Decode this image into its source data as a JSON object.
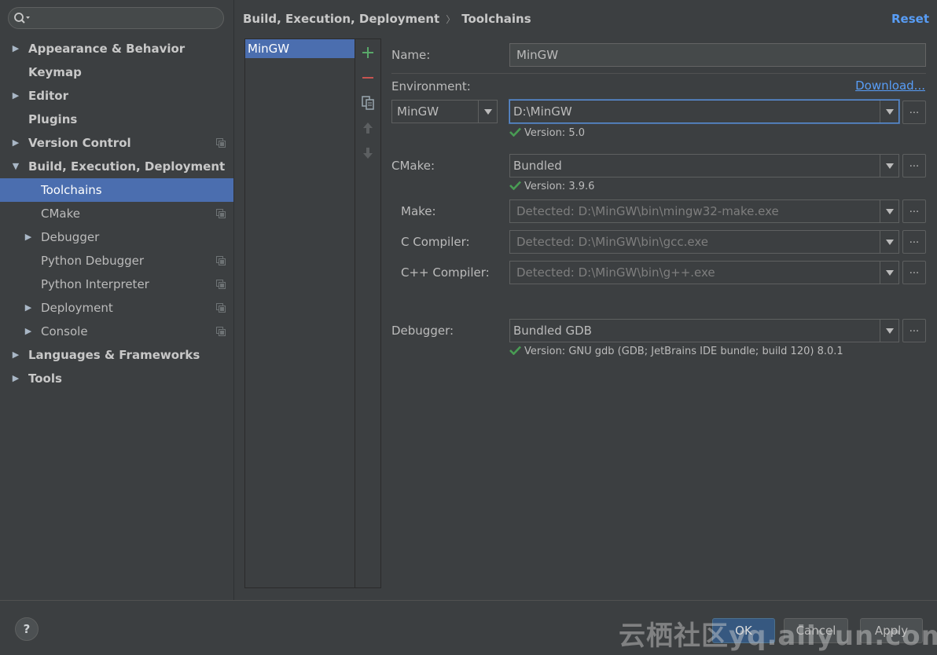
{
  "search": {
    "placeholder": "",
    "value": ""
  },
  "tree": [
    {
      "label": "Appearance & Behavior",
      "bold": true,
      "arrow": "right",
      "level": 0
    },
    {
      "label": "Keymap",
      "bold": true,
      "arrow": "",
      "level": 0
    },
    {
      "label": "Editor",
      "bold": true,
      "arrow": "right",
      "level": 0
    },
    {
      "label": "Plugins",
      "bold": true,
      "arrow": "",
      "level": 0
    },
    {
      "label": "Version Control",
      "bold": true,
      "arrow": "right",
      "level": 0,
      "project_icon": true
    },
    {
      "label": "Build, Execution, Deployment",
      "bold": true,
      "arrow": "down",
      "level": 0
    },
    {
      "label": "Toolchains",
      "bold": false,
      "arrow": "",
      "level": 1,
      "selected": true
    },
    {
      "label": "CMake",
      "bold": false,
      "arrow": "",
      "level": 1,
      "project_icon": true
    },
    {
      "label": "Debugger",
      "bold": false,
      "arrow": "right",
      "level": 1
    },
    {
      "label": "Python Debugger",
      "bold": false,
      "arrow": "",
      "level": 1,
      "project_icon": true
    },
    {
      "label": "Python Interpreter",
      "bold": false,
      "arrow": "",
      "level": 1,
      "project_icon": true
    },
    {
      "label": "Deployment",
      "bold": false,
      "arrow": "right",
      "level": 1,
      "project_icon": true
    },
    {
      "label": "Console",
      "bold": false,
      "arrow": "right",
      "level": 1,
      "project_icon": true
    },
    {
      "label": "Languages & Frameworks",
      "bold": true,
      "arrow": "right",
      "level": 0
    },
    {
      "label": "Tools",
      "bold": true,
      "arrow": "right",
      "level": 0
    }
  ],
  "header": {
    "breadcrumb_parent": "Build, Execution, Deployment",
    "breadcrumb_sep": "〉",
    "breadcrumb_current": "Toolchains",
    "reset_label": "Reset"
  },
  "toolchains": {
    "items": [
      "MinGW"
    ],
    "toolbar_icons": [
      "add-icon",
      "remove-icon",
      "copy-icon",
      "move-up-icon",
      "move-down-icon"
    ]
  },
  "form": {
    "name_label": "Name:",
    "name_value": "MinGW",
    "environment_label": "Environment:",
    "download_label": "Download...",
    "env_type": "MinGW",
    "env_path": "D:\\MinGW",
    "env_version": "Version: 5.0",
    "cmake_label": "CMake:",
    "cmake_value": "Bundled",
    "cmake_version": "Version: 3.9.6",
    "make_label": "Make:",
    "make_value": "Detected: D:\\MinGW\\bin\\mingw32-make.exe",
    "c_label": "C Compiler:",
    "c_value": "Detected: D:\\MinGW\\bin\\gcc.exe",
    "cpp_label": "C++ Compiler:",
    "cpp_value": "Detected: D:\\MinGW\\bin\\g++.exe",
    "debugger_label": "Debugger:",
    "debugger_value": "Bundled GDB",
    "debugger_version": "Version: GNU gdb (GDB; JetBrains IDE bundle; build 120) 8.0.1",
    "browse_label": "..."
  },
  "footer": {
    "help_label": "?",
    "ok_label": "OK",
    "cancel_label": "Cancel",
    "apply_label": "Apply",
    "watermark": "云栖社区yq.aliyun.com"
  },
  "colors": {
    "background": "#3c3f41",
    "selection": "#4b6eaf",
    "link": "#589df6",
    "success": "#499c54",
    "add": "#59a869",
    "remove": "#c75450"
  }
}
